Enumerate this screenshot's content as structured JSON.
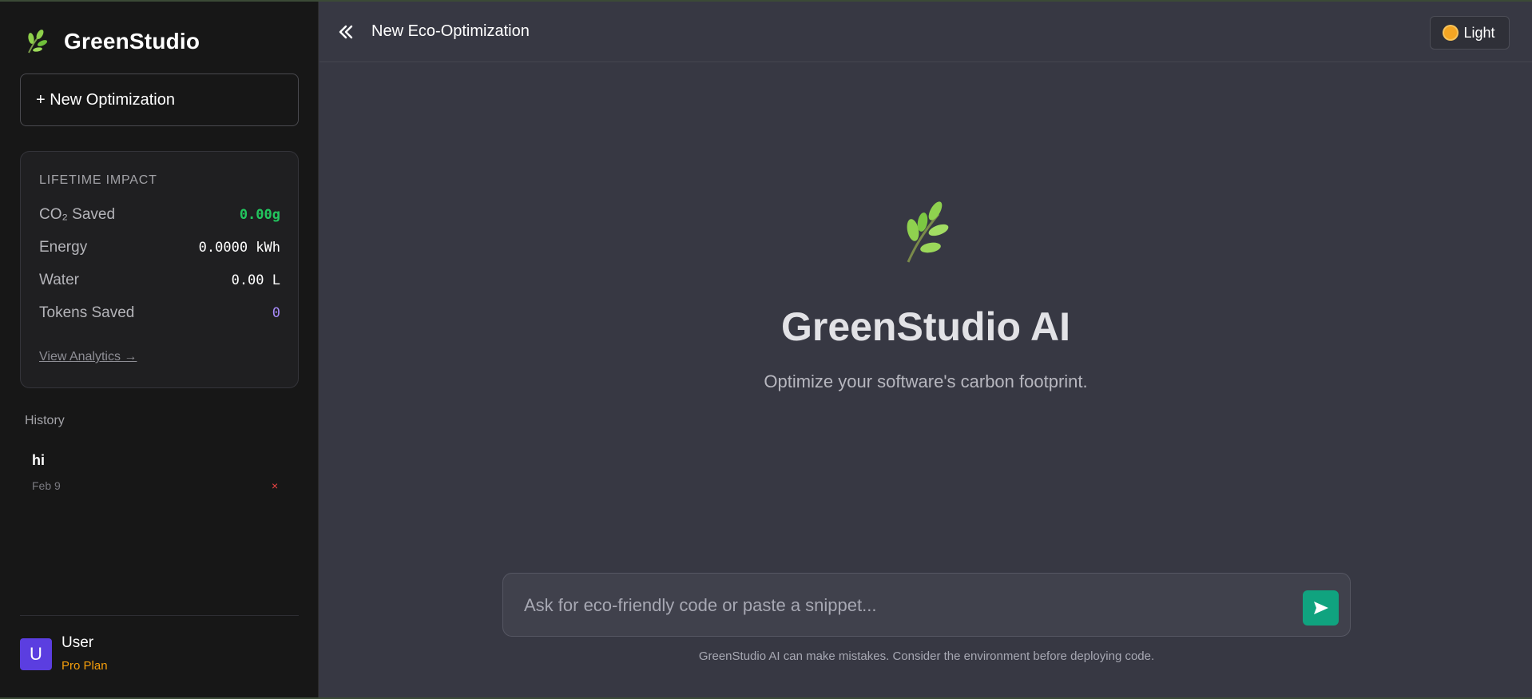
{
  "colors": {
    "background": "#373843",
    "sidebar": "#171717",
    "accent_green": "#22c55e",
    "send_button": "#10a37f",
    "avatar": "#5b3ee0",
    "plan": "#f59e0b",
    "tokens": "#a78bfa",
    "delete": "#ef4444"
  },
  "icons": {
    "brand": "leaf-sprout-icon",
    "hero": "leaf-sprout-icon",
    "collapse": "double-chevron-left-icon",
    "theme": "sun-icon",
    "send": "send-arrow-icon"
  },
  "sidebar": {
    "brand_name": "GreenStudio",
    "new_optimization_label": "+ New Optimization",
    "impact": {
      "title": "LIFETIME IMPACT",
      "rows": [
        {
          "label": "CO₂ Saved",
          "value": "0.00g"
        },
        {
          "label": "Energy",
          "value": "0.0000 kWh"
        },
        {
          "label": "Water",
          "value": "0.00 L"
        },
        {
          "label": "Tokens Saved",
          "value": "0"
        }
      ],
      "view_analytics": "View Analytics →"
    },
    "history_label": "History",
    "history": [
      {
        "title": "hi",
        "date": "Feb 9",
        "delete": "×"
      }
    ],
    "user": {
      "initial": "U",
      "name": "User",
      "plan": "Pro Plan"
    }
  },
  "header": {
    "title": "New Eco-Optimization",
    "theme_label": "Light"
  },
  "hero": {
    "title": "GreenStudio AI",
    "subtitle": "Optimize your software's carbon footprint."
  },
  "composer": {
    "placeholder": "Ask for eco-friendly code or paste a snippet...",
    "value": "",
    "disclaimer": "GreenStudio AI can make mistakes. Consider the environment before deploying code."
  }
}
